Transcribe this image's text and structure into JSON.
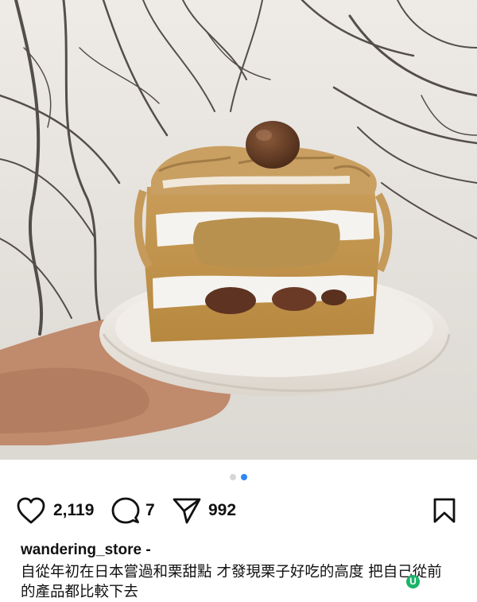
{
  "post": {
    "image": {
      "description": "slice of chestnut cake on white plate",
      "carousel_total": 2,
      "carousel_active_index": 1
    },
    "actions": {
      "likes": "2,119",
      "comments": "7",
      "shares": "992",
      "like_icon": "heart-icon",
      "comment_icon": "comment-bubble-icon",
      "share_icon": "paper-plane-icon",
      "save_icon": "bookmark-icon"
    },
    "username": "wandering_store -",
    "caption": "自從年初在日本嘗過和栗甜點 才發現栗子好吃的高度 把自己從前的產品都比較下去",
    "badge": "U"
  },
  "colors": {
    "accent": "#2e88f0",
    "dot_inactive": "#d6d6d6",
    "badge_green": "#1bb36a"
  }
}
